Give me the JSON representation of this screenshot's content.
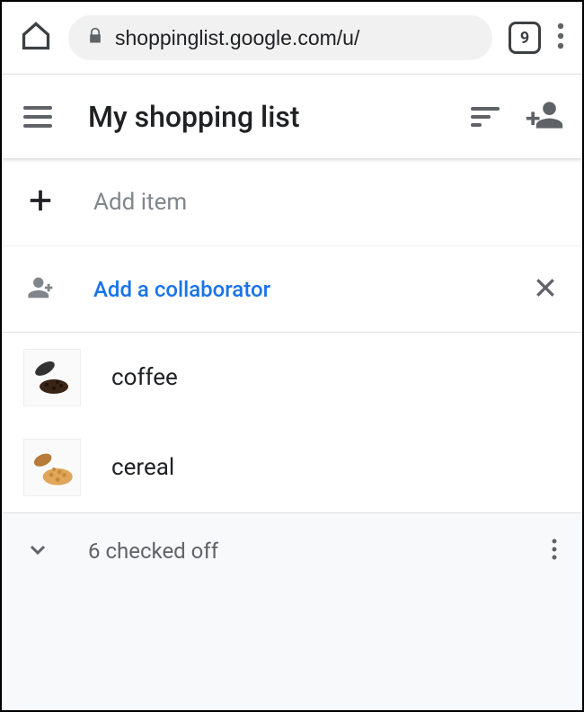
{
  "browser": {
    "url": "shoppinglist.google.com/u/",
    "tab_count": "9"
  },
  "header": {
    "title": "My shopping list"
  },
  "add_item": {
    "placeholder": "Add item"
  },
  "collaborator": {
    "label": "Add a collaborator"
  },
  "items": [
    {
      "label": "coffee"
    },
    {
      "label": "cereal"
    }
  ],
  "checked_off": {
    "label": "6 checked off"
  }
}
